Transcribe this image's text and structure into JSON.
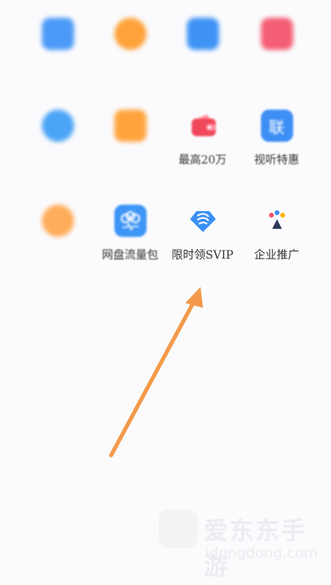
{
  "grid": {
    "rows": [
      [
        {
          "label": "",
          "icon": "blurred-blue-icon",
          "blur": true
        },
        {
          "label": "",
          "icon": "blurred-orange-icon",
          "blur": true
        },
        {
          "label": "",
          "icon": "blurred-blue-icon",
          "blur": true
        },
        {
          "label": "",
          "icon": "blurred-red-icon",
          "blur": true
        }
      ],
      [
        {
          "label": "",
          "icon": "blurred-blue-circle-icon",
          "blur": true
        },
        {
          "label": "",
          "icon": "blurred-orange-bag-icon",
          "blur": true
        },
        {
          "label": "最高20万",
          "icon": "wallet-icon",
          "blur": false
        },
        {
          "label": "视听特惠",
          "icon": "lian-badge-icon",
          "blur": false
        }
      ],
      [
        {
          "label": "",
          "icon": "blurred-orange-icon",
          "blur": true
        },
        {
          "label": "网盘流量包",
          "icon": "cloud-ticket-icon",
          "blur": false
        },
        {
          "label": "限时领SVIP",
          "icon": "svip-diamond-icon",
          "blur": false
        },
        {
          "label": "企业推广",
          "icon": "baidu-paw-icon",
          "blur": false
        }
      ]
    ],
    "lian_glyph": "联"
  },
  "watermark": {
    "title": "爱东东手游",
    "sub": "idongdong.com"
  },
  "colors": {
    "arrow": "#f39a4a",
    "blue": "#3f8ef5",
    "orange": "#ff9a2e",
    "red": "#f2526a",
    "wallet": "#f0465a"
  }
}
